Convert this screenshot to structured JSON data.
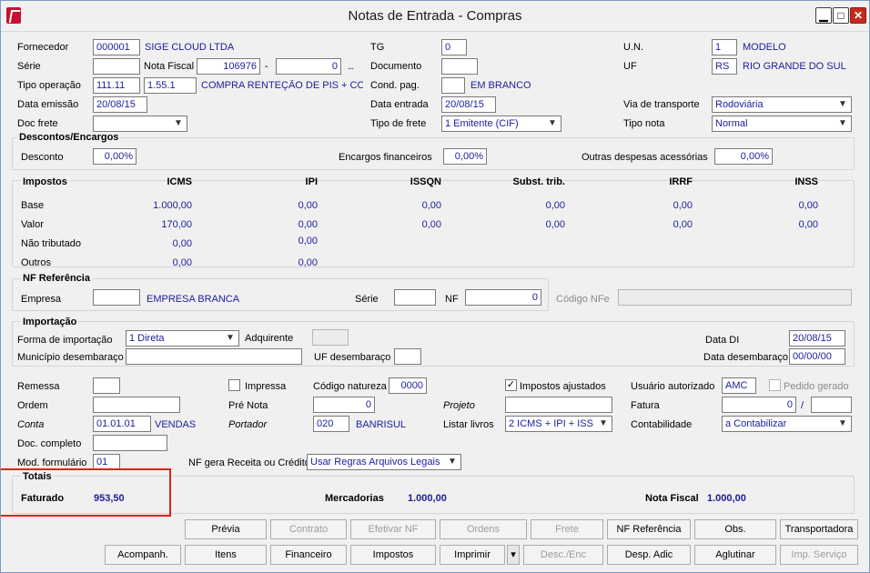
{
  "window": {
    "title": "Notas de Entrada - Compras",
    "min": "▁",
    "max": "□",
    "close": "✕"
  },
  "header": {
    "fornecedor_label": "Fornecedor",
    "fornecedor_code": "000001",
    "fornecedor_name": "SIGE CLOUD LTDA",
    "serie_label": "Série",
    "serie_value": "",
    "nota_fiscal_label": "Nota Fiscal",
    "nota_fiscal_value": "106976",
    "nota_fiscal_dash": "-",
    "nota_fiscal_sub": "0",
    "nota_fiscal_dots": "...",
    "tipo_operacao_label": "Tipo operação",
    "tipo_operacao_code1": "111.11",
    "tipo_operacao_code2": "1.55.1",
    "tipo_operacao_desc": "COMPRA RENTEÇÃO DE PIS + COFI!",
    "data_emissao_label": "Data emissão",
    "data_emissao_value": "20/08/15",
    "doc_frete_label": "Doc frete",
    "doc_frete_value": "",
    "tg_label": "TG",
    "tg_value": "0",
    "documento_label": "Documento",
    "documento_value": "",
    "cond_pag_label": "Cond. pag.",
    "cond_pag_value": "",
    "cond_pag_desc": "EM BRANCO",
    "data_entrada_label": "Data entrada",
    "data_entrada_value": "20/08/15",
    "tipo_frete_label": "Tipo de frete",
    "tipo_frete_value": "1 Emitente (CIF)",
    "un_label": "U.N.",
    "un_code": "1",
    "un_desc": "MODELO",
    "uf_label": "UF",
    "uf_code": "RS",
    "uf_desc": "RIO GRANDE DO SUL",
    "via_label": "Via de transporte",
    "via_value": "Rodoviária",
    "tipo_nota_label": "Tipo nota",
    "tipo_nota_value": "Normal"
  },
  "descontos": {
    "title": "Descontos/Encargos",
    "desconto_label": "Desconto",
    "desconto_value": "0,00%",
    "encargos_label": "Encargos financeiros",
    "encargos_value": "0,00%",
    "outras_label": "Outras despesas acessórias",
    "outras_value": "0,00%"
  },
  "impostos": {
    "title": "Impostos",
    "columns": [
      "ICMS",
      "IPI",
      "ISSQN",
      "Subst. trib.",
      "IRRF",
      "INSS"
    ],
    "rows": [
      {
        "label": "Base",
        "values": [
          "1.000,00",
          "0,00",
          "0,00",
          "0,00",
          "0,00",
          "0,00"
        ]
      },
      {
        "label": "Valor",
        "values": [
          "170,00",
          "0,00",
          "0,00",
          "0,00",
          "0,00",
          "0,00"
        ]
      },
      {
        "label": "Não tributado",
        "values": [
          "0,00",
          "0,00"
        ]
      },
      {
        "label": "Outros",
        "values": [
          "0,00",
          "0,00"
        ]
      }
    ]
  },
  "nf_referencia": {
    "title": "NF Referência",
    "empresa_label": "Empresa",
    "empresa_value": "",
    "empresa_desc": "EMPRESA BRANCA",
    "serie_label": "Série",
    "serie_value": "",
    "nf_label": "NF",
    "nf_value": "0",
    "codigo_nfe_label": "Código NFe",
    "codigo_nfe_value": ""
  },
  "importacao": {
    "title": "Importação",
    "forma_label": "Forma de importação",
    "forma_value": "1 Direta",
    "adquirente_label": "Adquirente",
    "adquirente_value": "",
    "municipio_label": "Município desembaraço",
    "municipio_value": "",
    "uf_label": "UF desembaraço",
    "uf_value": "",
    "data_di_label": "Data DI",
    "data_di_value": "20/08/15",
    "data_desemb_label": "Data desembaraço",
    "data_desemb_value": "00/00/00"
  },
  "misc": {
    "remessa_label": "Remessa",
    "remessa_value": "",
    "impressa_label": "Impressa",
    "codigo_natureza_label": "Código natureza",
    "codigo_natureza_value": "0000",
    "impostos_ajustados_label": "Impostos ajustados",
    "impostos_ajustados_mark": "✓",
    "usuario_label": "Usuário autorizado",
    "usuario_value": "AMC",
    "pedido_label": "Pedido gerado",
    "ordem_label": "Ordem",
    "ordem_value": "",
    "pre_nota_label": "Pré Nota",
    "pre_nota_value": "0",
    "projeto_label": "Projeto",
    "projeto_value": "",
    "fatura_label": "Fatura",
    "fatura_value": "0",
    "fatura_sep": "/",
    "fatura_value2": "",
    "conta_label": "Conta",
    "conta_value": "01.01.01",
    "conta_desc": "VENDAS",
    "portador_label": "Portador",
    "portador_value": "020",
    "portador_desc": "BANRISUL",
    "listar_label": "Listar livros",
    "listar_value": "2 ICMS + IPI + ISS",
    "contabilidade_label": "Contabilidade",
    "contabilidade_value": "a Contabilizar",
    "doc_completo_label": "Doc. completo",
    "doc_completo_value": "",
    "mod_form_label": "Mod. formulário",
    "mod_form_value": "01",
    "nf_gera_label": "NF gera Receita ou Crédito",
    "nf_gera_value": "Usar Regras Arquivos Legais"
  },
  "totais": {
    "title": "Totais",
    "faturado_label": "Faturado",
    "faturado_value": "953,50",
    "mercadorias_label": "Mercadorias",
    "mercadorias_value": "1.000,00",
    "nota_fiscal_label": "Nota Fiscal",
    "nota_fiscal_value": "1.000,00"
  },
  "buttons": {
    "previa": "Prévia",
    "contrato": "Contrato",
    "efetivar": "Efetivar NF",
    "ordens": "Ordens",
    "frete": "Frete",
    "nf_referencia": "NF Referência",
    "obs": "Obs.",
    "transportadora": "Transportadora",
    "acompanh": "Acompanh.",
    "itens": "Itens",
    "financeiro": "Financeiro",
    "impostos": "Impostos",
    "imprimir": "Imprimir",
    "desc_enc": "Desc./Enc",
    "desp_adic": "Desp. Adic",
    "aglutinar": "Aglutinar",
    "imp_servico": "Imp. Serviço"
  },
  "colors": {
    "value_blue": "#1c1c9e",
    "highlight_red": "#e0201c",
    "close_red": "#c42b1c"
  }
}
